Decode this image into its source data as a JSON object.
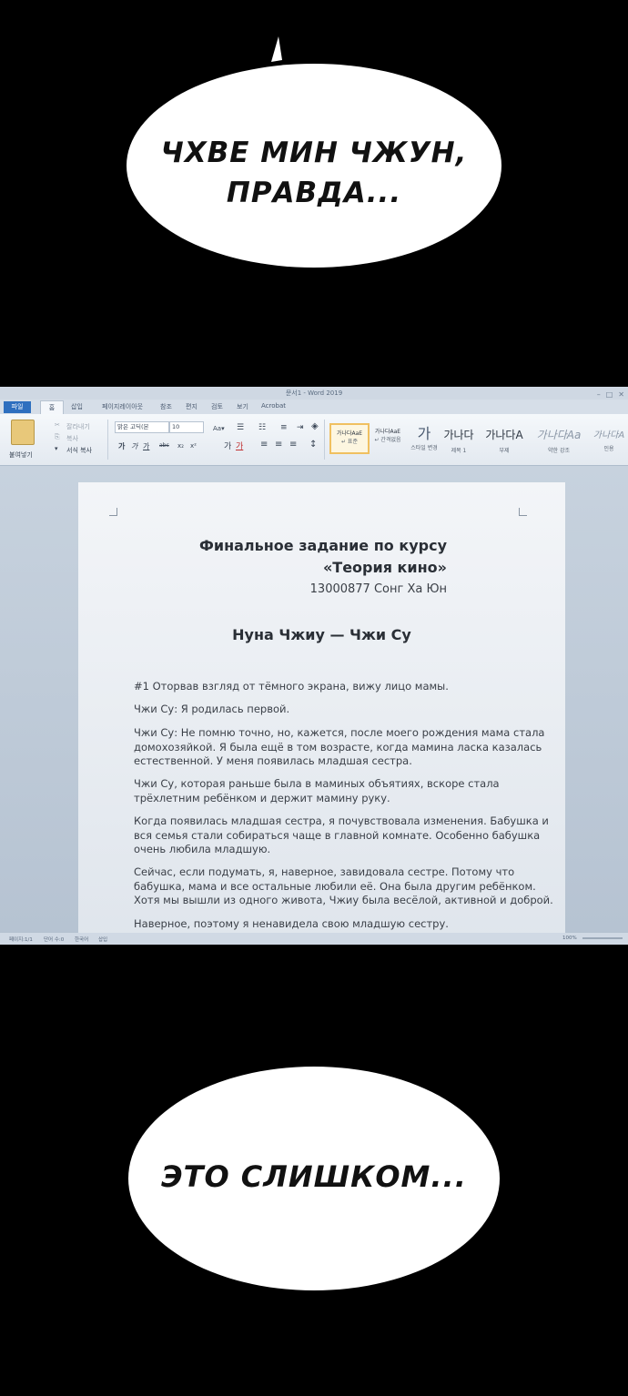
{
  "bubble_top": {
    "text_line1": "Чхве Мин Чжун,",
    "text_line2": "правда..."
  },
  "bubble_bottom": {
    "text": "Это слишком..."
  },
  "word": {
    "window_title": "문서1 - Word 2019",
    "tabs": [
      "파일",
      "홈",
      "삽입",
      "페이지레이아웃",
      "참조",
      "편지",
      "검토",
      "보기",
      "Acrobat"
    ],
    "ribbon": {
      "paste": "붙여넣기",
      "cut": "잘라내기",
      "copy": "복사",
      "format_painter": "서식 복사",
      "font_name": "맑은 고딕(본",
      "font_size": "10",
      "styles": [
        {
          "sample": "가나다AaE",
          "name": "↵ 표준"
        },
        {
          "sample": "가나다AaE",
          "name": "↵ 간격없음"
        },
        {
          "sample": "가",
          "name": "스타일 변경"
        },
        {
          "sample": "가나다",
          "name": "제목 1"
        },
        {
          "sample": "가나다A",
          "name": "부제"
        },
        {
          "sample": "가나다Aa",
          "name": "약한 강조"
        },
        {
          "sample": "가나다A",
          "name": "인용"
        }
      ]
    },
    "document": {
      "title_line1": "Финальное задание по курсу",
      "title_line2": "«Теория кино»",
      "author": "13000877 Сонг Ха Юн",
      "subtitle": "Нуна Чжиу — Чжи Су",
      "paragraphs": [
        "#1 Оторвав взгляд от тёмного экрана, вижу лицо мамы.",
        "Чжи Су: Я родилась первой.",
        "Чжи Су: Не помню точно, но, кажется, после моего рождения мама стала домохозяйкой. Я была ещё в том возрасте, когда мамина ласка казалась естественной. У меня появилась младшая сестра.",
        "Чжи Су, которая раньше была в маминых объятиях, вскоре стала трёхлетним ребёнком и держит мамину руку.",
        "Когда появилась младшая сестра, я почувствовала изменения. Бабушка и вся семья стали собираться чаще в главной комнате. Особенно бабушка очень любила младшую.",
        "Сейчас, если подумать, я, наверное, завидовала сестре. Потому что бабушка, мама и все остальные любили её. Она была другим ребёнком. Хотя мы вышли из одного живота, Чжиу была весёлой, активной и доброй.",
        "Наверное, поэтому я ненавидела свою младшую сестру."
      ]
    },
    "status": {
      "page": "페이지:1/1",
      "words": "단어 수:0",
      "language": "한국어",
      "mode": "삽입",
      "zoom": "100%"
    }
  }
}
